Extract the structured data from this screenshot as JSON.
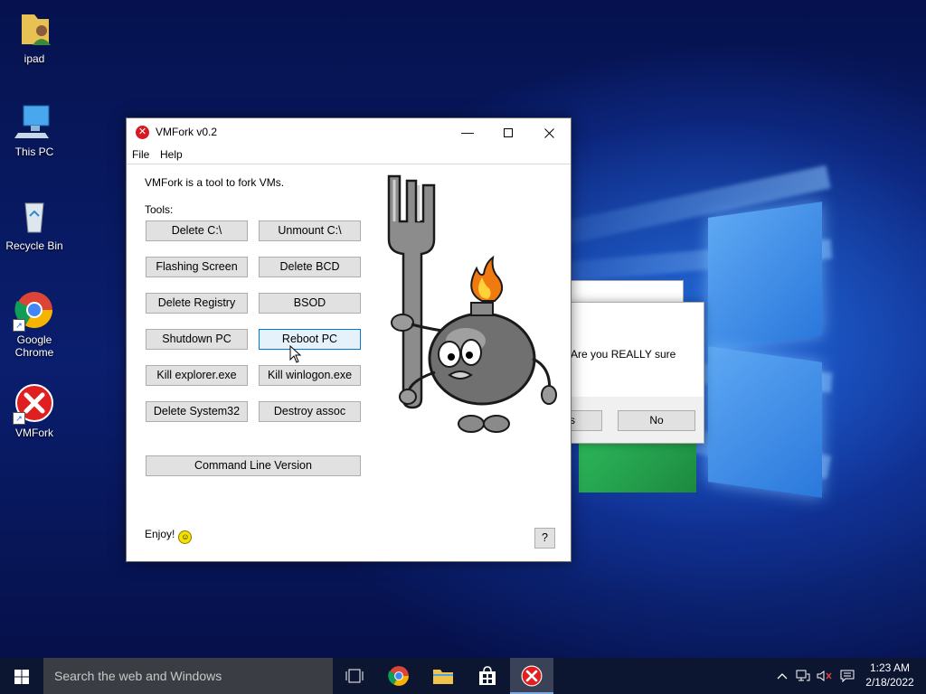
{
  "colors": {
    "accent": "#0078d7",
    "taskbar": "#0c1630",
    "error_red": "#d71921"
  },
  "desktop": {
    "icons": [
      {
        "label": "ipad",
        "icon": "user-folder-icon"
      },
      {
        "label": "This PC",
        "icon": "computer-icon"
      },
      {
        "label": "Recycle Bin",
        "icon": "recycle-bin-icon"
      },
      {
        "label": "Google Chrome",
        "icon": "chrome-icon"
      },
      {
        "label": "VMFork",
        "icon": "red-x-icon"
      }
    ]
  },
  "window": {
    "title": "VMFork v0.2",
    "menu": [
      "File",
      "Help"
    ],
    "description": "VMFork is a tool to fork VMs.",
    "tools_label": "Tools:",
    "buttons": [
      "Delete C:\\",
      "Unmount C:\\",
      "Flashing Screen",
      "Delete BCD",
      "Delete Registry",
      "BSOD",
      "Shutdown PC",
      "Reboot PC",
      "Kill explorer.exe",
      "Kill winlogon.exe",
      "Delete System32",
      "Destroy assoc"
    ],
    "cmd_button": "Command Line Version",
    "footer": "Enjoy!",
    "help_button": "?"
  },
  "dialog": {
    "message": "Are you REALLY sure",
    "yes_partial": "s",
    "no": "No"
  },
  "taskbar": {
    "search_placeholder": "Search the web and Windows",
    "time": "1:23 AM",
    "date": "2/18/2022"
  }
}
